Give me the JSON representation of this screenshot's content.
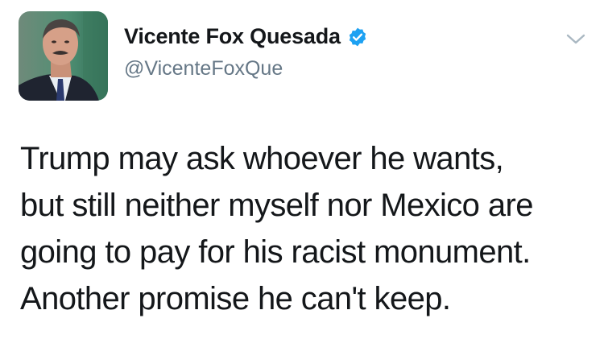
{
  "author": {
    "display_name": "Vicente Fox Quesada",
    "handle": "@VicenteFoxQue",
    "verified": true,
    "avatar_icon": "profile-photo"
  },
  "tweet": {
    "lines": [
      "Trump may ask whoever he wants,",
      "but still neither myself nor Mexico are",
      "going to pay for his racist monument.",
      "Another promise he can't keep."
    ]
  },
  "icons": {
    "verified": "verified-badge-icon",
    "menu": "chevron-down-icon"
  },
  "colors": {
    "text": "#14171a",
    "handle": "#657786",
    "verified": "#1da1f2",
    "caret": "#aab8c2"
  }
}
